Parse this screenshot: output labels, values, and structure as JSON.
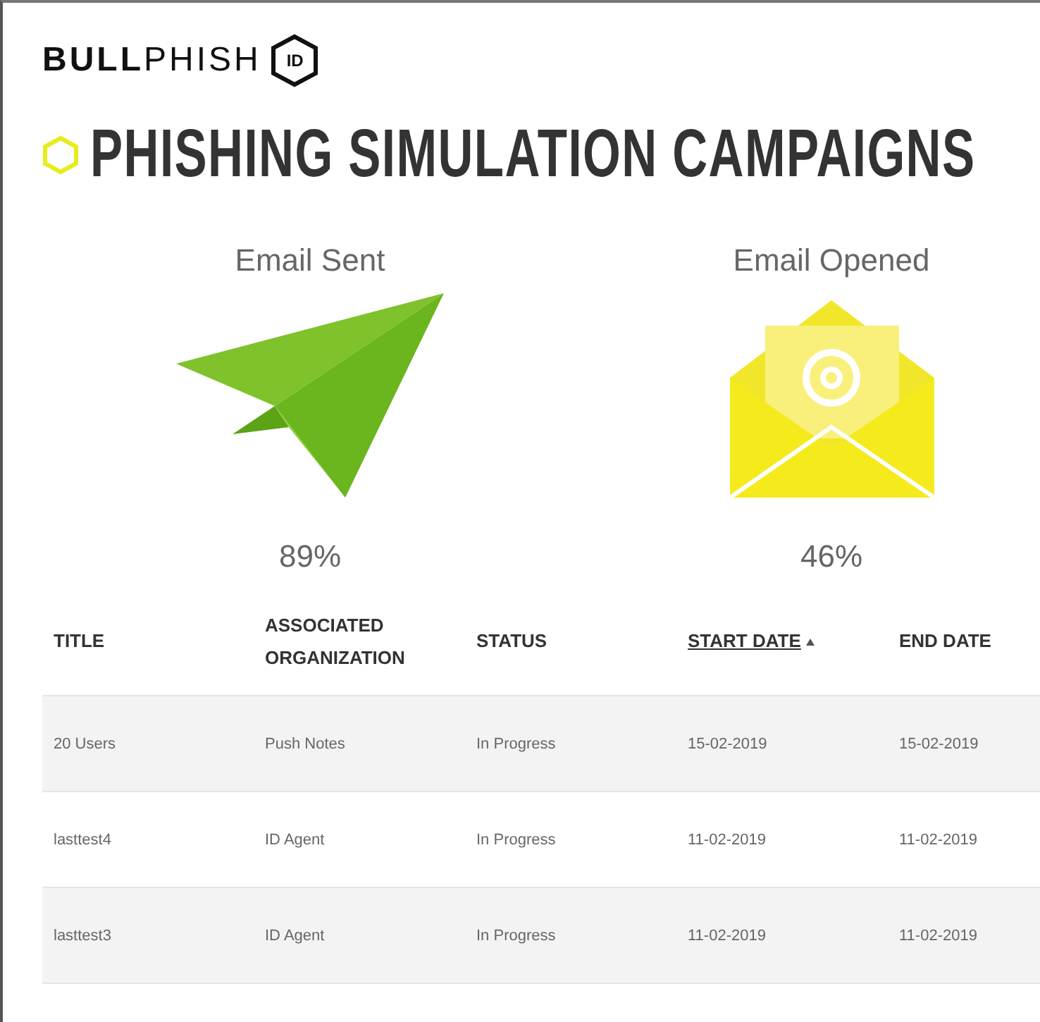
{
  "logo": {
    "wordmark": "**BULL**PHISH",
    "badge": "ID"
  },
  "title": "PHISHING SIMULATION CAMPAIGNS",
  "stats": [
    {
      "kind": "plane",
      "label": "Email Sent",
      "value": "89%"
    },
    {
      "kind": "envelope",
      "label": "Email Opened",
      "value": "46%"
    }
  ],
  "table": {
    "columns": [
      {
        "label": "TITLE",
        "sorted": false
      },
      {
        "label": "ASSOCIATED ORGANIZATION",
        "sorted": false
      },
      {
        "label": "STATUS",
        "sorted": false
      },
      {
        "label": "START DATE",
        "sorted": true
      },
      {
        "label": "END DATE",
        "sorted": false
      }
    ],
    "rows": [
      [
        "20 Users",
        "Push Notes",
        "In Progress",
        "15-02-2019",
        "15-02-2019"
      ],
      [
        "lasttest4",
        "ID Agent",
        "In Progress",
        "11-02-2019",
        "11-02-2019"
      ],
      [
        "lasttest3",
        "ID Agent",
        "In Progress",
        "11-02-2019",
        "11-02-2019"
      ]
    ]
  }
}
